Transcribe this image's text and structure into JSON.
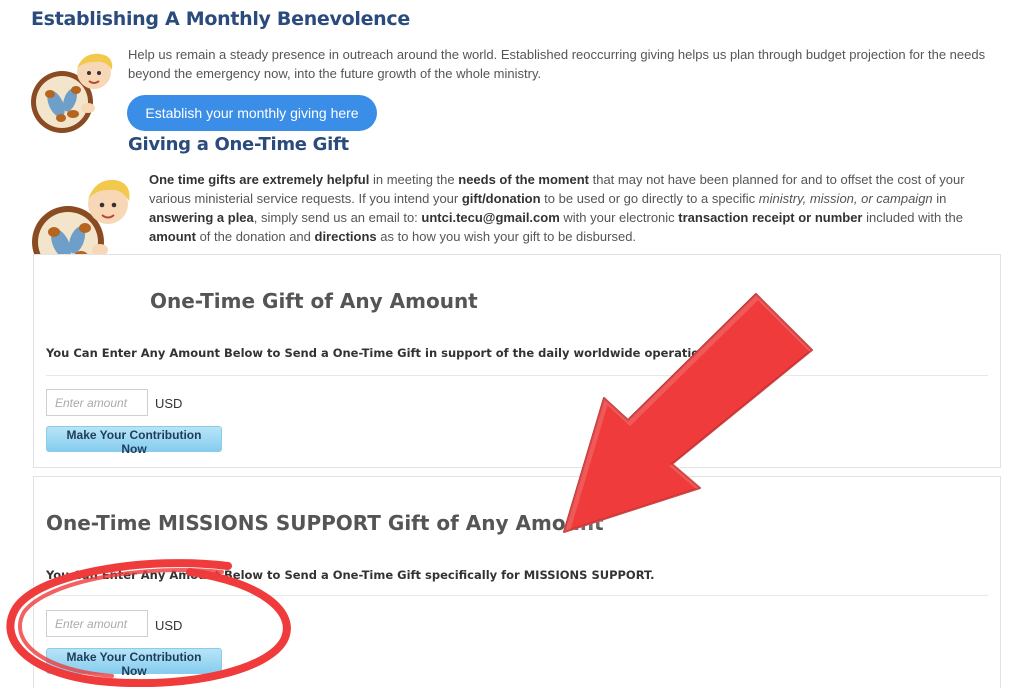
{
  "monthly": {
    "heading": "Establishing A Monthly Benevolence",
    "text": "Help us remain a steady presence in outreach around the world. Established reoccurring giving helps us plan through budget projection for the needs beyond the emergency now, into the future growth of the whole ministry.",
    "button_label": "Establish your monthly giving here"
  },
  "onetime": {
    "heading": "Giving a One-Time Gift",
    "t1": "One time gifts are extremely helpful",
    "t2": " in meeting the ",
    "t3": "needs of the moment",
    "t4": " that may not have been planned for and to offset the cost of your various ministerial service requests.  If you intend your ",
    "t5": "gift/donation",
    "t6": " to be used or go directly to a specific ",
    "t7": "ministry, mission, or campaign",
    "t8": " in ",
    "t9": "answering a plea",
    "t10": ", simply send us an email to: ",
    "t11": "untci.tecu@gmail.com",
    "t12": " with your electronic ",
    "t13": "transaction receipt or number",
    "t14": " included with the ",
    "t15": "amount",
    "t16": " of the donation and ",
    "t17": "directions",
    "t18": " as to how you wish your gift to be disbursed."
  },
  "box1": {
    "title": "One-Time Gift of Any Amount",
    "description": "You Can Enter Any Amount Below to Send a One-Time Gift in support of the daily worldwide operations of UNT",
    "placeholder": "Enter amount",
    "currency": "USD",
    "button_label": "Make Your Contribution Now"
  },
  "box2": {
    "title": "One-Time MISSIONS SUPPORT Gift of Any Amount",
    "description": "You Can Enter Any Amount Below to Send a One-Time Gift specifically for MISSIONS SUPPORT.",
    "placeholder": "Enter amount",
    "currency": "USD",
    "button_label": "Make Your Contribution Now"
  },
  "colors": {
    "heading": "#2a4b7c",
    "monthly_button": "#3b8ee8",
    "annotation": "#ef3b3b"
  },
  "icons": [
    "boy-with-fish-and-loaves-icon",
    "red-arrow-annotation",
    "red-circle-annotation"
  ]
}
